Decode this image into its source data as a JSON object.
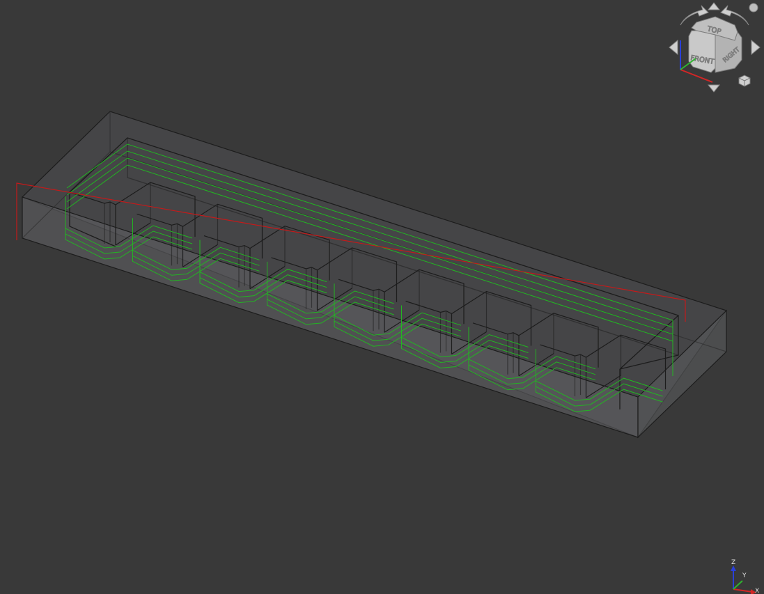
{
  "viewport": {
    "background": "#393939"
  },
  "navcube": {
    "faces": {
      "top": "TOP",
      "front": "FRONT",
      "right": "RIGHT"
    }
  },
  "axis_triad": {
    "x": "X",
    "y": "Y",
    "z": "Z"
  },
  "colors": {
    "model_edges": "#1c1c1c",
    "toolpath": "#22b522",
    "rapid_move": "#c41a1a",
    "stock_fill": "#5a5b5e"
  },
  "model": {
    "pocket_count": 8,
    "toolpath_offsets": 3
  }
}
